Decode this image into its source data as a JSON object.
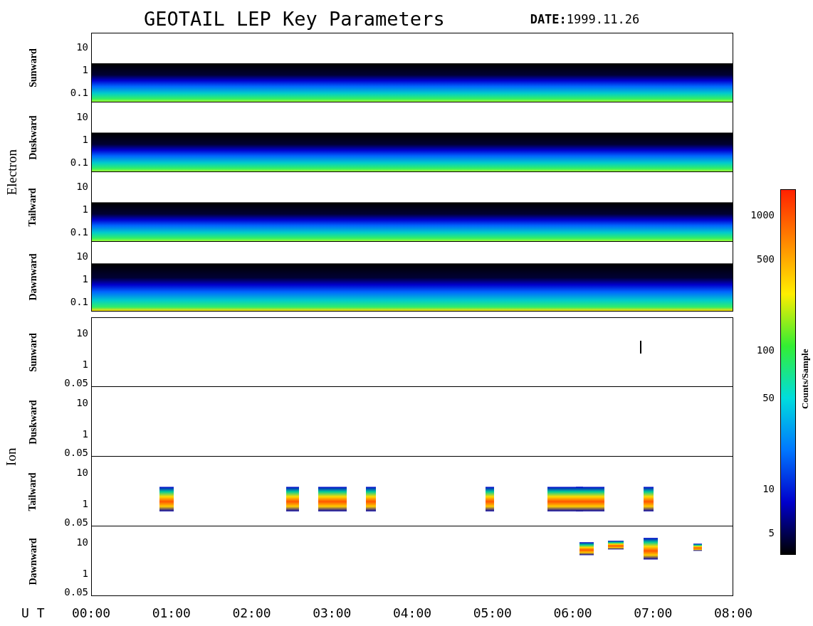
{
  "title": "GEOTAIL LEP Key Parameters",
  "date": {
    "label": "DATE:",
    "value": "1999.11.26"
  },
  "groups": [
    {
      "name": "Electron",
      "panels": [
        {
          "label": "Sunward",
          "kind": "spectrogram",
          "yticks": [
            "10",
            "1",
            "0.1"
          ]
        },
        {
          "label": "Duskward",
          "kind": "spectrogram",
          "yticks": [
            "10",
            "1",
            "0.1"
          ]
        },
        {
          "label": "Tailward",
          "kind": "spectrogram",
          "yticks": [
            "10",
            "1",
            "0.1"
          ]
        },
        {
          "label": "Dawnward",
          "kind": "spectrogram",
          "yticks": [
            "10",
            "1",
            "0.1"
          ]
        }
      ]
    },
    {
      "name": "Ion",
      "panels": [
        {
          "label": "Sunward",
          "kind": "trace",
          "yticks": [
            "10",
            "1",
            "0.05"
          ]
        },
        {
          "label": "Duskward",
          "kind": "empty",
          "yticks": [
            "10",
            "1",
            "0.05"
          ]
        },
        {
          "label": "Tailward",
          "kind": "bursts",
          "yticks": [
            "10",
            "1",
            "0.05"
          ]
        },
        {
          "label": "Dawnward",
          "kind": "patches",
          "yticks": [
            "10",
            "1",
            "0.05"
          ]
        }
      ]
    }
  ],
  "x_axis": {
    "label": "U T",
    "ticks": [
      "00:00",
      "01:00",
      "02:00",
      "03:00",
      "04:00",
      "05:00",
      "06:00",
      "07:00",
      "08:00"
    ]
  },
  "colorbar": {
    "label": "Counts/Sample",
    "ticks": [
      "1000",
      "500",
      "100",
      "50",
      "10",
      "5"
    ]
  }
}
